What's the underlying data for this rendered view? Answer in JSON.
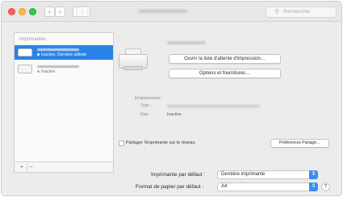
{
  "window": {
    "search_placeholder": "Rechercher"
  },
  "toolbar": {
    "back_glyph": "‹",
    "forward_glyph": "›",
    "grid_glyph": "⋮⋮⋮"
  },
  "sidebar": {
    "header": "Imprimantes",
    "items": [
      {
        "status": "Inactive, Dernière utilisée",
        "selected": true,
        "icon": "printer-icon"
      },
      {
        "status": "Inactive",
        "selected": false,
        "icon": "printer-icon"
      }
    ],
    "add_glyph": "+",
    "remove_glyph": "−"
  },
  "details": {
    "open_queue_label": "Ouvrir la liste d'attente d'impression…",
    "options_label": "Options et fournitures…",
    "location_label": "Emplacement :",
    "type_label": "Type :",
    "state_label": "État :",
    "state_value": "Inactive",
    "share_label": "Partager l'imprimante sur le réseau.",
    "share_prefs_label": "Préférences Partage…"
  },
  "bottom": {
    "default_printer_label": "Imprimante par défaut :",
    "default_printer_value": "Dernière imprimante",
    "default_paper_label": "Format de papier par défaut :",
    "default_paper_value": "A4",
    "help_glyph": "?"
  },
  "colors": {
    "selection": "#2b82e6",
    "popup_accent": "#3b8ef0",
    "close": "#fc605c",
    "minimize": "#fdbc40",
    "maximize": "#34c84a"
  }
}
